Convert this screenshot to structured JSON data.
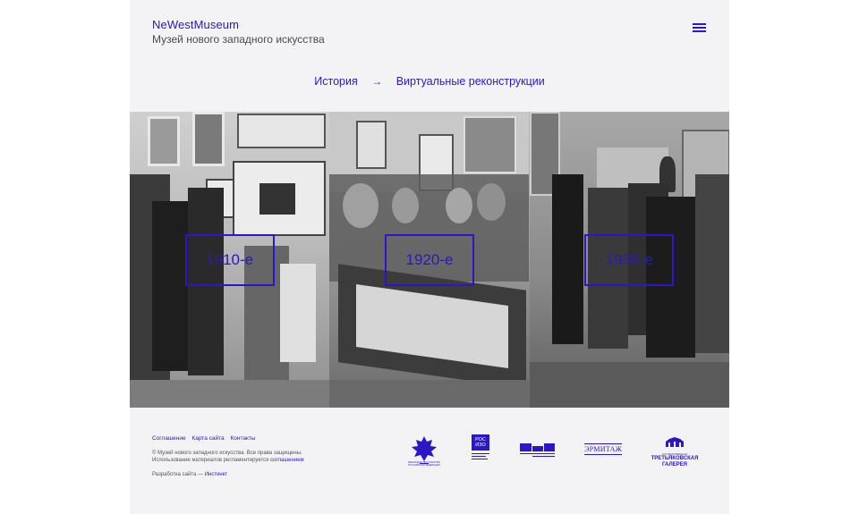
{
  "header": {
    "brand_name": "NeWestMuseum",
    "brand_subtitle": "Музей нового западного искусства",
    "menu_icon": "hamburger-icon"
  },
  "breadcrumb": {
    "items": [
      "История",
      "Виртуальные реконструкции"
    ],
    "separator_icon": "arrow-right-icon"
  },
  "tiles": [
    {
      "label": "1910-е"
    },
    {
      "label": "1920-е"
    },
    {
      "label": "1930-е"
    }
  ],
  "footer": {
    "links": [
      "Соглашение",
      "Карта сайта",
      "Контакты"
    ],
    "copyright_line1": "© Музей нового западного искусства. Все права защищены.",
    "copyright_line2_prefix": "Использование материалов регламентируется",
    "copyright_line2_link": "соглашением",
    "developer_prefix": "Разработка сайта —",
    "developer_link": "Инстинкт",
    "logos": {
      "mincult": "МИНИСТЕРСТВО КУЛЬТУРЫ РОССИЙСКОЙ ФЕДЕРАЦИИ",
      "rosizo": "РОС ИЗО",
      "hermitage": "ЭРМИТАЖ",
      "tretyakov_small": "ГОСУДАРСТВЕННАЯ",
      "tretyakov": "ТРЕТЬЯКОВСКАЯ ГАЛЕРЕЯ"
    }
  },
  "colors": {
    "accent": "#2a18c8",
    "page_bg": "#f3f3f5",
    "outer_bg": "#ffffff"
  }
}
